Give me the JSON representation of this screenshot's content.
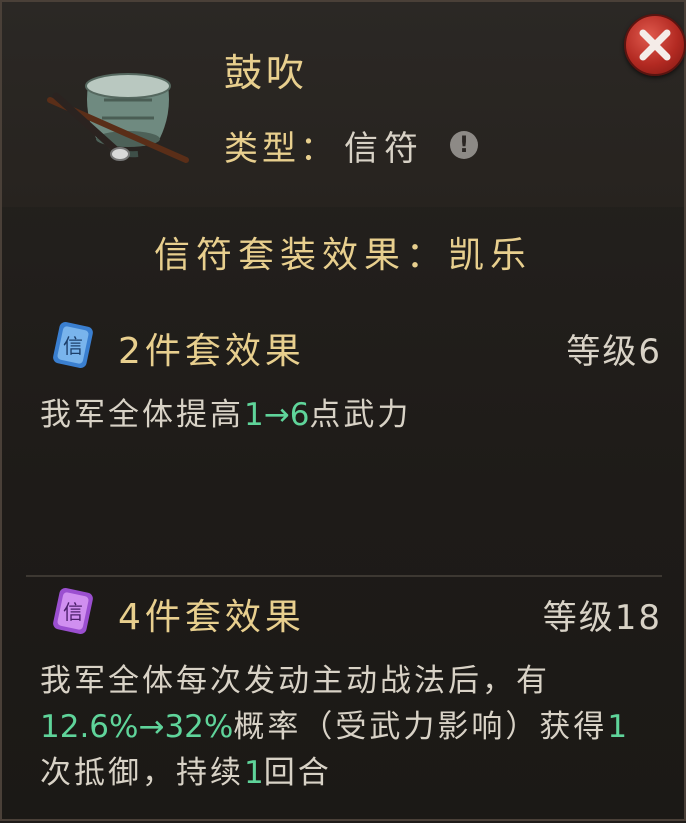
{
  "item": {
    "name": "鼓吹",
    "type_label": "类型：",
    "type_value": "信符",
    "icon": "war-drum-with-flute-icon"
  },
  "close": {
    "icon": "close-icon"
  },
  "info": {
    "icon": "info-icon",
    "glyph": "!"
  },
  "set": {
    "title": "信符套装效果：凯乐"
  },
  "tiers": [
    {
      "title": "2件套效果",
      "level": "等级6",
      "badge_glyph": "信",
      "badge_color": "#3a7fd0",
      "desc": {
        "p1": "我军全体提高",
        "v1": "1→6",
        "p2": "点武力"
      }
    },
    {
      "title": "4件套效果",
      "level": "等级18",
      "badge_glyph": "信",
      "badge_color": "#9b4fd0",
      "desc": {
        "p1": "我军全体每次发动主动战法后，有",
        "v1": "12.6%→32%",
        "p2": "概率（受武力影响）获得",
        "v2": "1",
        "p3": "次抵御，持续",
        "v3": "1",
        "p4": "回合"
      }
    }
  ],
  "colors": {
    "gold": "#e8cf8e",
    "text": "#d8d2c6",
    "highlight": "#5fd49a",
    "close_red": "#b32a22"
  }
}
